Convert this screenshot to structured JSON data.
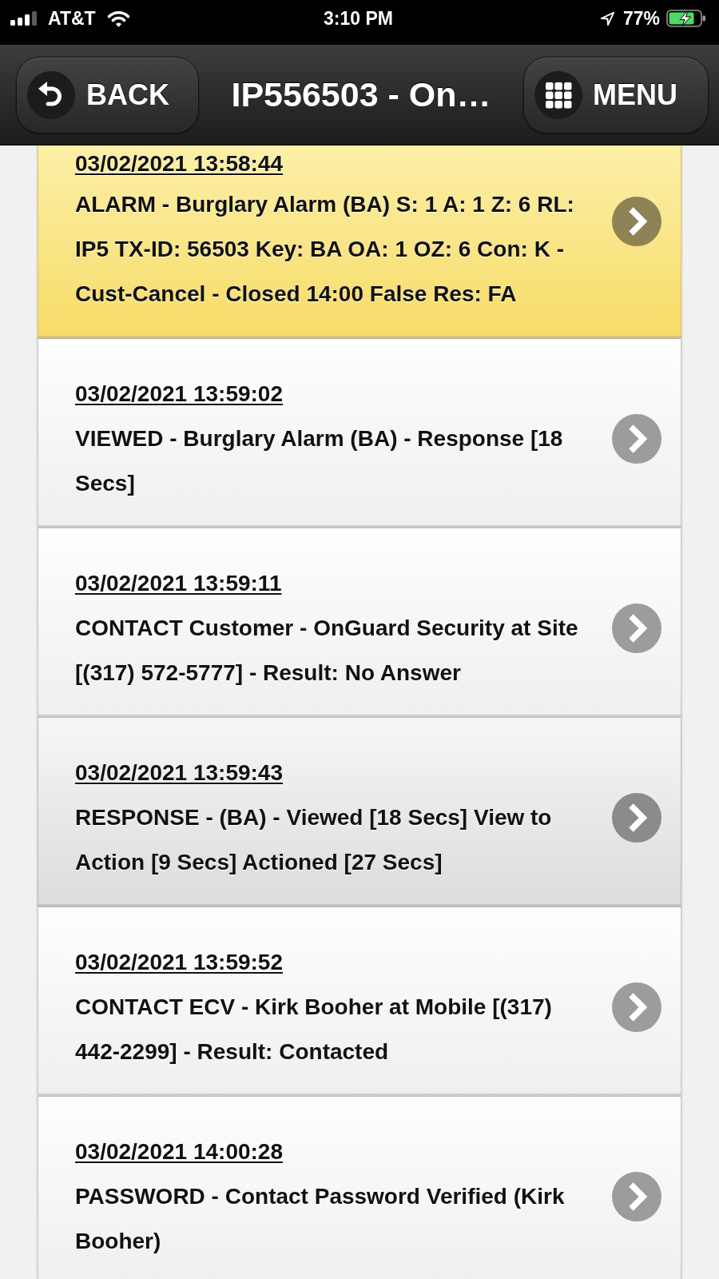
{
  "status_bar": {
    "carrier": "AT&T",
    "time": "3:10 PM",
    "battery": "77%"
  },
  "header": {
    "back_button": "BACK",
    "title": "IP556503 - On…",
    "menu_button": "MENU"
  },
  "events": [
    {
      "kind": "alarm",
      "timestamp": "03/02/2021 13:58:44",
      "description": "ALARM - Burglary Alarm (BA) S: 1 A: 1 Z: 6 RL: IP5 TX-ID: 56503 Key: BA OA: 1 OZ: 6 Con: K - Cust-Cancel - Closed 14:00 False Res: FA"
    },
    {
      "kind": "event",
      "timestamp": "03/02/2021 13:59:02",
      "description": "VIEWED - Burglary Alarm (BA) - Response [18 Secs]"
    },
    {
      "kind": "event",
      "timestamp": "03/02/2021 13:59:11",
      "description": "CONTACT Customer - OnGuard Security at Site [(317) 572-5777] - Result: No Answer"
    },
    {
      "kind": "response",
      "timestamp": "03/02/2021 13:59:43",
      "description": "RESPONSE - (BA) - Viewed [18 Secs] View to Action [9 Secs] Actioned [27 Secs]"
    },
    {
      "kind": "event",
      "timestamp": "03/02/2021 13:59:52",
      "description": "CONTACT ECV - Kirk Booher at Mobile [(317) 442-2299] - Result: Contacted"
    },
    {
      "kind": "event",
      "timestamp": "03/02/2021 14:00:28",
      "description": "PASSWORD - Contact Password Verified (Kirk Booher)"
    }
  ]
}
